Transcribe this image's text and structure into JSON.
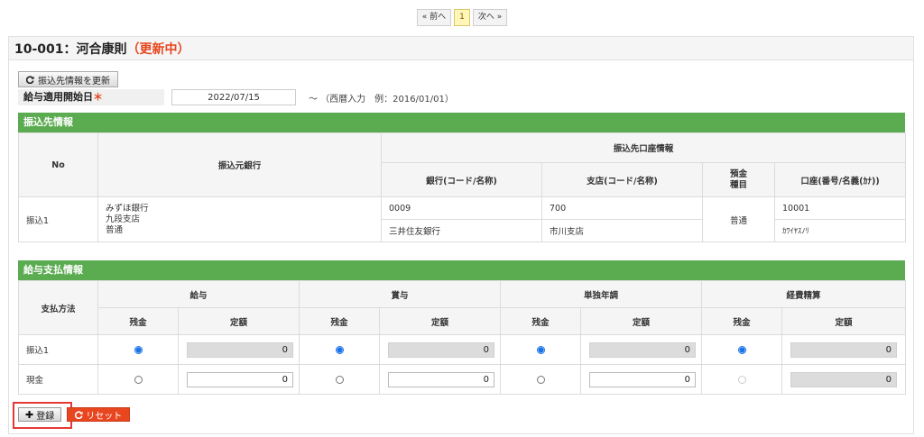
{
  "pager": {
    "prev": "« 前へ",
    "page": "1",
    "next": "次へ »"
  },
  "header": {
    "title": "10-001：河合康則",
    "status": "（更新中）"
  },
  "form": {
    "update_button": "振込先情報を更新",
    "start_label": "給与適用開始日",
    "required_mark": "＊",
    "start_value": "2022/07/15",
    "hint": "～ （西暦入力　例：2016/01/01）"
  },
  "transfer": {
    "section_title": "振込先情報",
    "headers": {
      "no": "No",
      "source_bank": "振込元銀行",
      "dest_info": "振込先口座情報",
      "bank": "銀行(コード/名称)",
      "branch": "支店(コード/名称)",
      "deposit_type": "預金\n種目",
      "account": "口座(番号/名義(ｶﾅ))"
    },
    "row": {
      "no": "振込1",
      "source_bank": "みずほ銀行\n九段支店\n普通",
      "bank_code": "0009",
      "bank_name": "三井住友銀行",
      "branch_code": "700",
      "branch_name": "市川支店",
      "deposit_type": "普通",
      "account_number": "10001",
      "account_name": "ｶﾜｲﾔｽﾉﾘ"
    }
  },
  "payment": {
    "section_title": "給与支払情報",
    "method_header": "支払方法",
    "groups": [
      "給与",
      "賞与",
      "単独年調",
      "経費精算"
    ],
    "sub_balance": "残金",
    "sub_fixed": "定額",
    "rows": [
      {
        "label": "振込1",
        "amounts": [
          "0",
          "0",
          "0",
          "0"
        ]
      },
      {
        "label": "現金",
        "amounts": [
          "0",
          "0",
          "0",
          "0"
        ]
      }
    ]
  },
  "actions": {
    "register": "登録",
    "reset": "リセット"
  },
  "colors": {
    "section": "#5bab50",
    "status": "#e8461f",
    "reset": "#e8461f",
    "highlight": "#e53935"
  },
  "icons": {
    "update": "refresh-icon",
    "register": "plus-icon",
    "reset": "refresh-icon"
  }
}
